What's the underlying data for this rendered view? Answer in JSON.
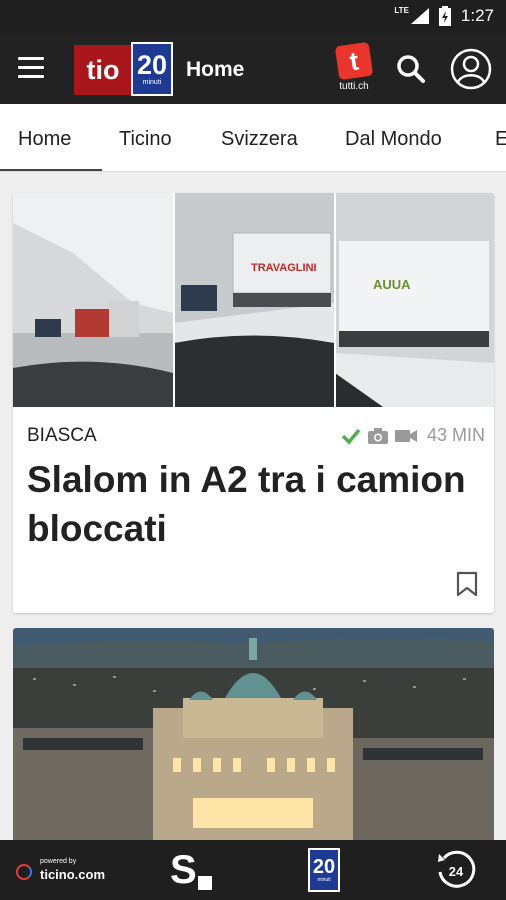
{
  "status_bar": {
    "network": "LTE",
    "time": "1:27"
  },
  "app_bar": {
    "logo_tio": "tio",
    "logo_20": "20",
    "logo_20_sub": "minuti",
    "title": "Home",
    "tutti_icon_letter": "t",
    "tutti_label": "tutti.ch"
  },
  "tabs": [
    "Home",
    "Ticino",
    "Svizzera",
    "Dal Mondo",
    "E"
  ],
  "active_tab": "Home",
  "article": {
    "category": "BIASCA",
    "time": "43 MIN",
    "headline": "Slalom in A2 tra i camion bloccati",
    "truck_text_1": "TRAVAGLINI",
    "truck_text_2": "AUUA"
  },
  "bottom_nav": {
    "ticino_powered": "powered by",
    "ticino_name": "ticino.com",
    "s_label": "S",
    "n20": "20",
    "n20_sub": "minuti",
    "clock_label": "24"
  },
  "colors": {
    "dark_bar": "#222222",
    "tio_red": "#a8161b",
    "blue_20": "#1f3a93",
    "tutti_red": "#e8362c",
    "check_green": "#4caf50"
  }
}
